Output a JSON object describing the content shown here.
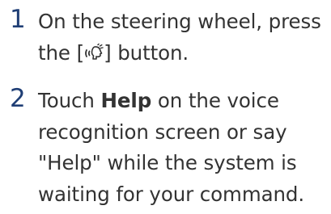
{
  "steps": [
    {
      "number": "1",
      "text_before": "On the steering wheel, press the [",
      "icon": "voice-recognition-icon",
      "text_after": "] button."
    },
    {
      "number": "2",
      "text_before": "Touch ",
      "bold": "Help",
      "text_after": " on the voice recognition screen or say \"Help\" while the system is waiting for your command."
    }
  ],
  "colors": {
    "step_number": "#1f3e75",
    "body_text": "#333333"
  }
}
